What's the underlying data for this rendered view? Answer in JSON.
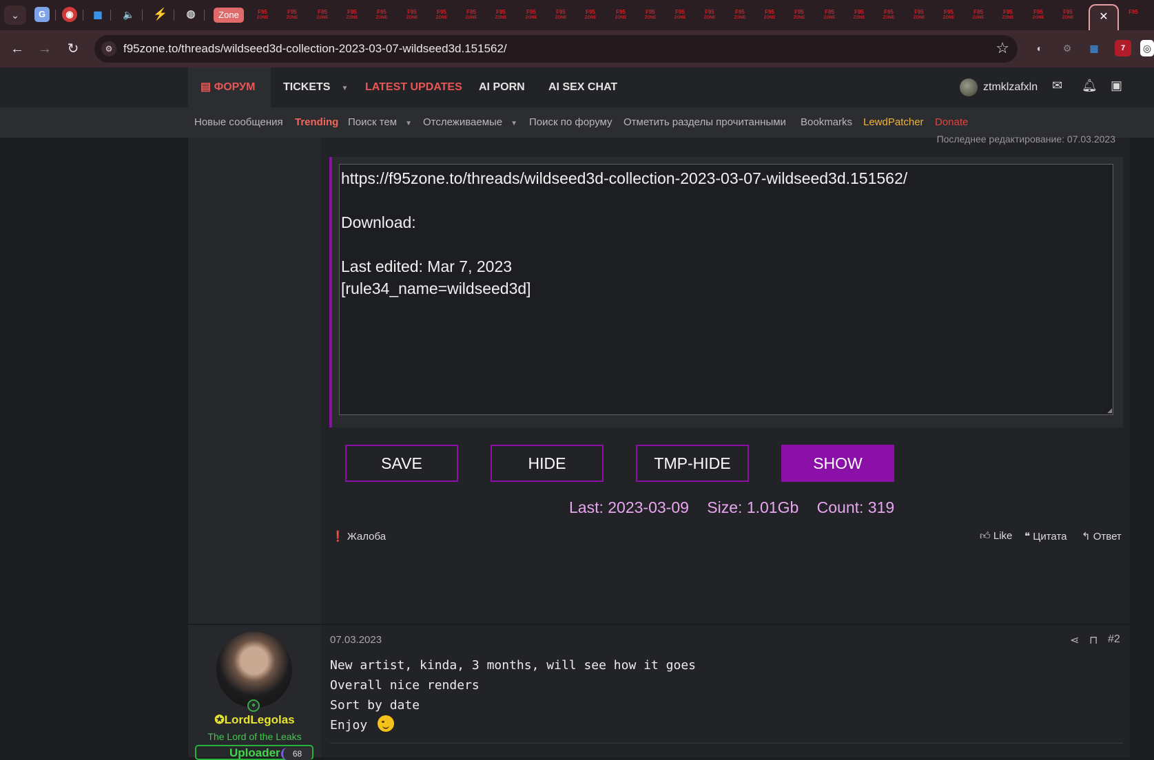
{
  "browser": {
    "pinned_tab_label": "Zone",
    "url": "f95zone.to/threads/wildseed3d-collection-2023-03-07-wildseed3d.151562/",
    "tab_favicon_text_top": "F95",
    "tab_favicon_text_bottom": "ZONE",
    "close_tab_symbol": "✕",
    "extension_badge": "7"
  },
  "header": {
    "nav": {
      "forum": "ФОРУМ",
      "tickets": "TICKETS",
      "latest_updates": "LATEST UPDATES",
      "ai_porn": "AI PORN",
      "ai_sex_chat": "AI SEX CHAT"
    },
    "username": "ztmklzafxln"
  },
  "subnav": {
    "new_messages": "Новые сообщения",
    "trending": "Trending",
    "search_topics": "Поиск тем",
    "watched": "Отслеживаемые",
    "search_forum": "Поиск по форуму",
    "mark_read": "Отметить разделы прочитанными",
    "bookmarks": "Bookmarks",
    "lewdpatcher": "LewdPatcher",
    "donate": "Donate"
  },
  "post1": {
    "last_edited": "Последнее редактирование: 07.03.2023",
    "textarea_value": "https://f95zone.to/threads/wildseed3d-collection-2023-03-07-wildseed3d.151562/\n\nDownload:\n\nLast edited: Mar 7, 2023\n[rule34_name=wildseed3d]",
    "buttons": {
      "save": "SAVE",
      "hide": "HIDE",
      "tmp_hide": "TMP-HIDE",
      "show": "SHOW"
    },
    "stats": {
      "last": "Last: 2023-03-09",
      "size": "Size: 1.01Gb",
      "count": "Count: 319"
    },
    "report": "Жалоба",
    "like": "Like",
    "quote": "Цитата",
    "reply": "Ответ"
  },
  "post2": {
    "date": "07.03.2023",
    "number": "#2",
    "author": "LordLegolas",
    "user_title": "The Lord of the Leaks",
    "badge": "Uploader",
    "badge_level": "68",
    "lines": [
      "New artist, kinda, 3 months, will see how it goes",
      "Overall nice renders",
      "Sort by date",
      "Enjoy"
    ]
  },
  "colors": {
    "accent_purple": "#8a10a8",
    "stats_pink": "#e8a6f0",
    "forum_red": "#ec5555",
    "trending": "#f2665c",
    "lewdpatcher": "#f0b43c",
    "donate": "#e0453f",
    "username_yellow": "#e7e430",
    "title_green": "#41c94a"
  }
}
